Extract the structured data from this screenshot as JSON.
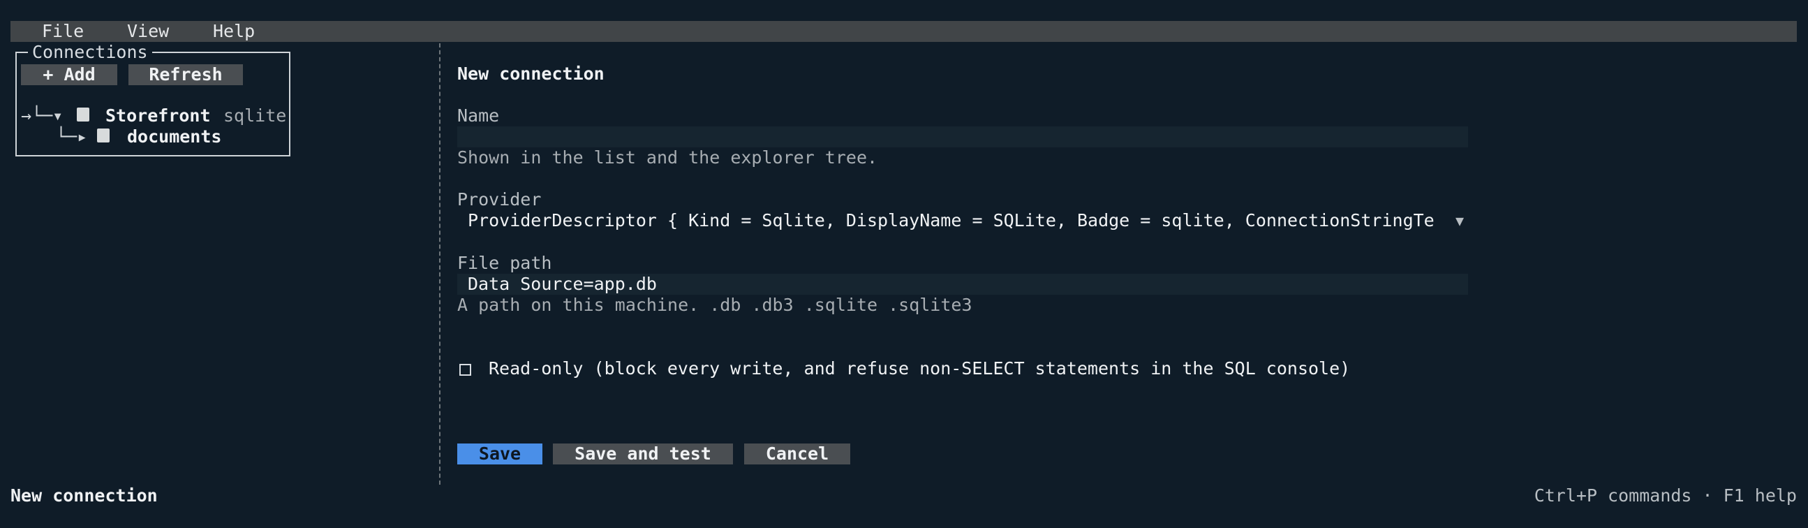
{
  "menu": {
    "items": [
      "File",
      "View",
      "Help"
    ]
  },
  "connections": {
    "title": "Connections",
    "add_label": "+ Add",
    "refresh_label": "Refresh",
    "tree": [
      {
        "prefix": "→└─▾",
        "name": "Storefront",
        "badge": "sqlite",
        "icon": "database-icon"
      },
      {
        "prefix": "└─▸",
        "name": "documents",
        "badge": "",
        "icon": "database-icon"
      }
    ]
  },
  "form": {
    "heading": "New connection",
    "name_label": "Name",
    "name_value": "",
    "name_hint": "Shown in the list and the explorer tree.",
    "provider_label": "Provider",
    "provider_value": "ProviderDescriptor { Kind = Sqlite, DisplayName = SQLite, Badge = sqlite, ConnectionStringTe",
    "provider_chevron": "▼",
    "file_path_label": "File path",
    "file_path_value": "Data Source=app.db",
    "file_path_hint": "A path on this machine. .db .db3 .sqlite .sqlite3",
    "readonly_label": "Read-only (block every write, and refuse non-SELECT statements in the SQL console)",
    "readonly_checked": false,
    "save_label": "Save",
    "save_test_label": "Save and test",
    "cancel_label": "Cancel"
  },
  "status": {
    "left": "New connection",
    "right": "Ctrl+P commands · F1 help"
  },
  "colors": {
    "background": "#0f1c28",
    "menubar": "#414548",
    "primary_button": "#4a8fe8",
    "secondary_button": "#4a4e52"
  }
}
